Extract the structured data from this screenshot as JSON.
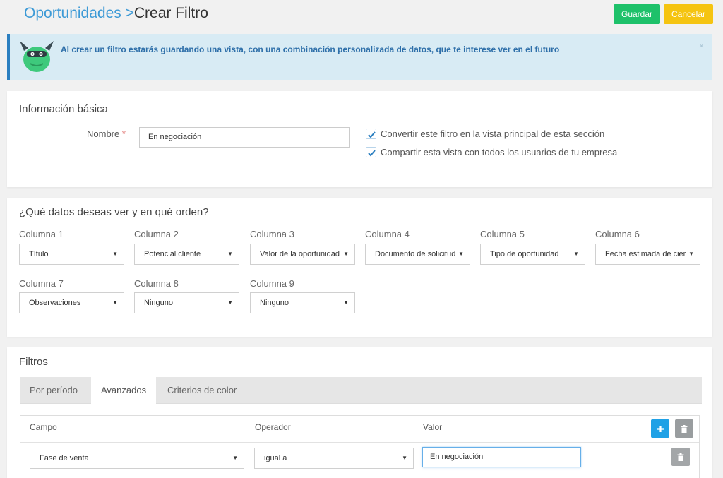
{
  "header": {
    "section": "Oportunidades",
    "separator": ">",
    "current": "Crear Filtro",
    "save_label": "Guardar",
    "cancel_label": "Cancelar"
  },
  "alert": {
    "message": "Al crear un filtro estarás guardando una vista, con una combinación personalizada de datos, que te interese ver en el futuro",
    "close": "×"
  },
  "basic": {
    "title": "Información básica",
    "name_label": "Nombre",
    "required_mark": "*",
    "name_value": "En negociación",
    "check_main_view": "Convertir este filtro en la vista principal de esta sección",
    "check_share": "Compartir esta vista con todos los usuarios de tu empresa",
    "check_main_view_checked": true,
    "check_share_checked": true
  },
  "columns": {
    "title": "¿Qué datos deseas ver y en qué orden?",
    "items": [
      {
        "label": "Columna 1",
        "value": "Título"
      },
      {
        "label": "Columna 2",
        "value": "Potencial cliente"
      },
      {
        "label": "Columna 3",
        "value": "Valor de la oportunidad"
      },
      {
        "label": "Columna 4",
        "value": "Documento de solicitud"
      },
      {
        "label": "Columna 5",
        "value": "Tipo de oportunidad"
      },
      {
        "label": "Columna 6",
        "value": "Fecha estimada de cierre"
      },
      {
        "label": "Columna 7",
        "value": "Observaciones"
      },
      {
        "label": "Columna 8",
        "value": "Ninguno"
      },
      {
        "label": "Columna 9",
        "value": "Ninguno"
      }
    ]
  },
  "filters": {
    "title": "Filtros",
    "tabs": [
      "Por período",
      "Avanzados",
      "Criterios de color"
    ],
    "active_tab": "Avanzados",
    "headers": {
      "field": "Campo",
      "operator": "Operador",
      "value": "Valor"
    },
    "rows": [
      {
        "field": "Fase de venta",
        "operator": "igual a",
        "value": "En negociación"
      }
    ]
  },
  "icons": {
    "add": "plus-icon",
    "delete": "trash-icon",
    "dropdown": "caret-down-icon",
    "check": "check-icon"
  },
  "colors": {
    "brand_blue": "#3d9ad6",
    "save": "#1ec16a",
    "cancel": "#f5c411",
    "alert_bg": "#d8ebf4",
    "add_button": "#1fa1e6",
    "mascot": "#3ec97c"
  }
}
